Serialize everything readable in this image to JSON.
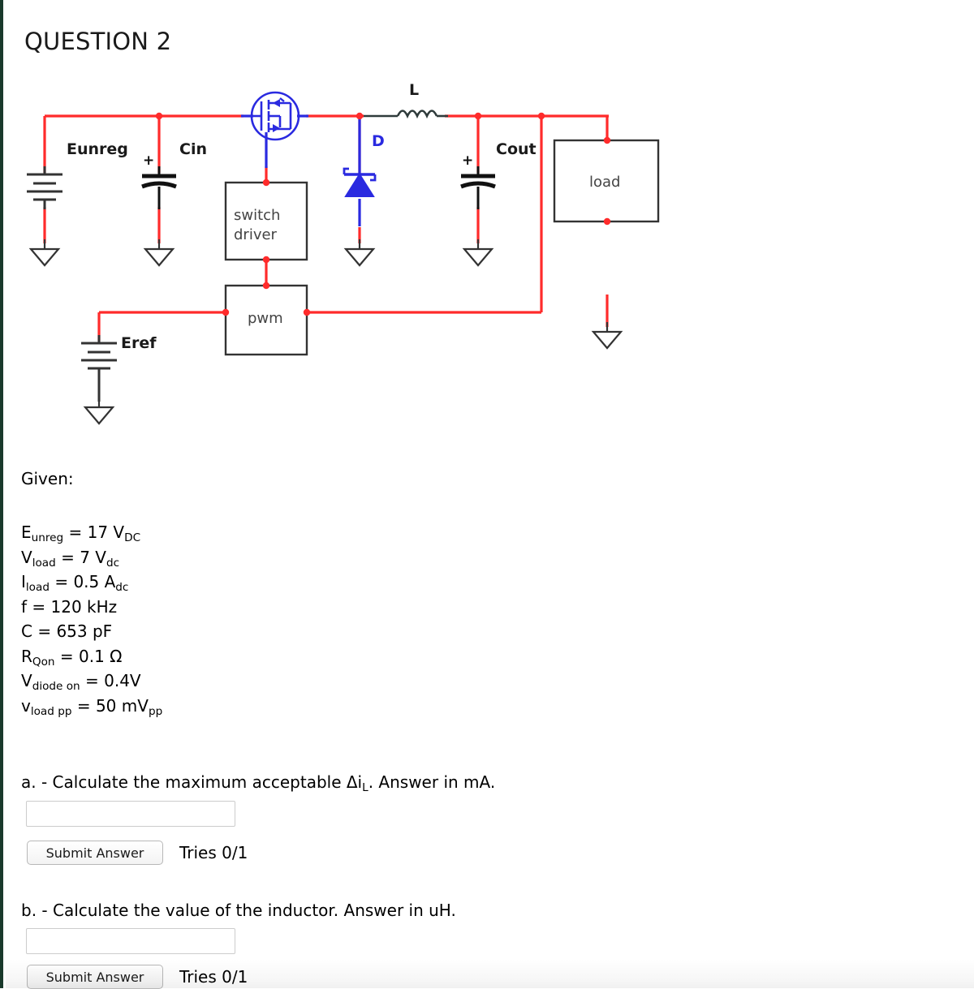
{
  "title": "QUESTION 2",
  "colors": {
    "wire_red": "#ff2b2b",
    "wire_blue": "#2a2ae0",
    "symbol_black": "#333333",
    "accent_edge": "#19392b"
  },
  "circuit": {
    "labels": {
      "source": "Eunreg",
      "cap_in": "Cin",
      "switch_driver_line1": "switch",
      "switch_driver_line2": "driver",
      "pwm": "pwm",
      "diode": "D",
      "inductor": "L",
      "cap_out": "Cout",
      "load": "load",
      "ref": "Eref",
      "plus_cin": "+",
      "plus_cout": "+"
    }
  },
  "given": {
    "heading": "Given:",
    "items": [
      {
        "sym": "E",
        "sub": "unreg",
        "eq": " = 17 V",
        "val_sub": "DC",
        "tail": ""
      },
      {
        "sym": "V",
        "sub": "load",
        "eq": " = 7 V",
        "val_sub": "dc",
        "tail": ""
      },
      {
        "sym": "I",
        "sub": "load",
        "eq": " = 0.5 A",
        "val_sub": "dc",
        "tail": ""
      },
      {
        "sym": "f",
        "sub": "",
        "eq": " = 120 kHz",
        "val_sub": "",
        "tail": ""
      },
      {
        "sym": "C",
        "sub": "",
        "eq": " = 653 pF",
        "val_sub": "",
        "tail": ""
      },
      {
        "sym": "R",
        "sub": "Qon",
        "eq": " = 0.1 Ω",
        "val_sub": "",
        "tail": ""
      },
      {
        "sym": "V",
        "sub": "diode on",
        "eq": " = 0.4V",
        "val_sub": "",
        "tail": ""
      },
      {
        "sym": "v",
        "sub": "load pp",
        "eq": " = 50 mV",
        "val_sub": "pp",
        "tail": ""
      }
    ]
  },
  "parts": {
    "a": {
      "prompt_pre": "a. - Calculate the maximum acceptable Δi",
      "prompt_sub": "L",
      "prompt_post": ". Answer in mA.",
      "input_value": "",
      "input_placeholder": "",
      "submit_label": "Submit Answer",
      "tries": "Tries 0/1"
    },
    "b": {
      "prompt_pre": "b. - Calculate the value of the inductor. Answer in uH.",
      "prompt_sub": "",
      "prompt_post": "",
      "input_value": "",
      "input_placeholder": "",
      "submit_label": "Submit Answer",
      "tries": "Tries 0/1"
    }
  }
}
